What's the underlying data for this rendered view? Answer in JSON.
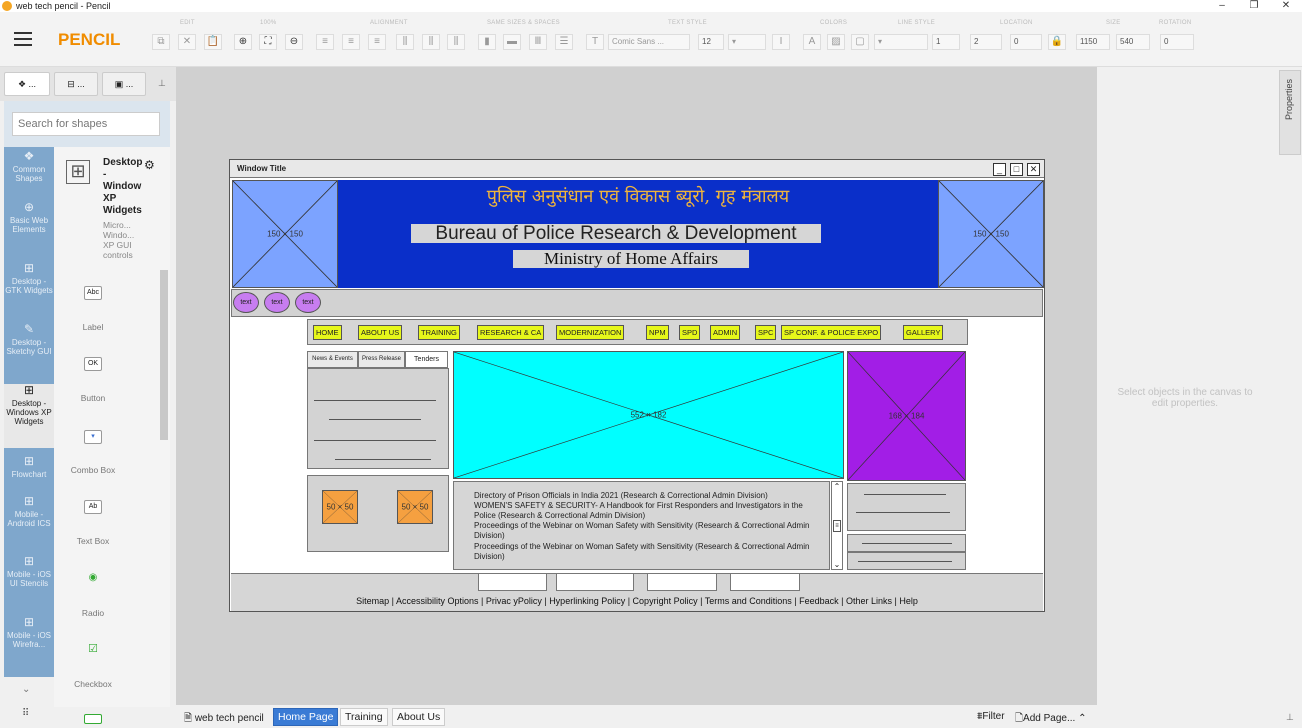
{
  "window": {
    "title": "web tech pencil - Pencil",
    "minimize": "–",
    "maximize": "❐",
    "close": "✕"
  },
  "app": {
    "name": "PENCIL"
  },
  "toolbar": {
    "groups": [
      "EDIT",
      "100%",
      "ALIGNMENT",
      "SAME SIZES & SPACES",
      "TEXT STYLE",
      "COLORS",
      "LINE STYLE",
      "LOCATION",
      "SIZE",
      "ROTATION"
    ],
    "font_family": "Comic Sans ...",
    "font_size": "12",
    "line_width": "1",
    "location_x": "2",
    "location_y": "0",
    "size_w": "1150",
    "size_h": "540",
    "rotation": "0"
  },
  "left": {
    "tab1": "...",
    "tab2": "...",
    "tab3": "...",
    "search_placeholder": "Search for shapes",
    "collections": [
      {
        "icon": "❖",
        "label": "Common Shapes"
      },
      {
        "icon": "⊕",
        "label": "Basic Web Elements"
      },
      {
        "icon": "⊞",
        "label": "Desktop - GTK Widgets"
      },
      {
        "icon": "✎",
        "label": "Desktop - Sketchy GUI"
      },
      {
        "icon": "⊞",
        "label": "Desktop - Windows XP Widgets"
      },
      {
        "icon": "⊞",
        "label": "Flowchart"
      },
      {
        "icon": "⊞",
        "label": "Mobile - Android ICS"
      },
      {
        "icon": "⊞",
        "label": "Mobile - iOS UI Stencils"
      },
      {
        "icon": "⊞",
        "label": "Mobile - iOS Wirefra..."
      }
    ],
    "collection_title": "Desktop - Window XP Widgets",
    "collection_desc": "Micro... Windo... XP GUI controls",
    "shapes": [
      {
        "icon": "Abc",
        "label": "Label"
      },
      {
        "icon": "OK",
        "label": "Button"
      },
      {
        "icon": "▾",
        "label": "Combo Box"
      },
      {
        "icon": "Ab",
        "label": "Text Box"
      },
      {
        "icon": "◉",
        "label": "Radio"
      },
      {
        "icon": "☑",
        "label": "Checkbox"
      }
    ]
  },
  "right": {
    "placeholder": "Select objects in the canvas to edit properties.",
    "properties_tab": "Properties"
  },
  "pages": {
    "doc": "web tech pencil",
    "tabs": [
      "Home Page",
      "Training",
      "About Us"
    ],
    "active": "Home Page",
    "filter": "Filter",
    "add_page": "Add Page..."
  },
  "mockup": {
    "window_title": "Window Title",
    "left_logo": "150 × 150",
    "right_logo": "150 × 150",
    "hindi_title": "पुलिस अनुसंधान एवं विकास ब्यूरो, गृह मंत्रालय",
    "bprd": "Bureau of Police Research & Development",
    "mha": "Ministry of Home Affairs",
    "circles": [
      "text",
      "text",
      "text"
    ],
    "nav": [
      "HOME",
      "ABOUT US",
      "TRAINING",
      "RESEARCH & CA",
      "MODERNIZATION",
      "NPM",
      "SPD",
      "ADMIN",
      "SPC",
      "SP CONF. & POLICE EXPO",
      "GALLERY"
    ],
    "side_tabs": [
      "News & Events",
      "Press Release",
      "Tenders"
    ],
    "hero": "552 × 182",
    "right_img": "168 × 184",
    "small1": "50 × 50",
    "small2": "50 × 50",
    "news": [
      "Directory of Prison Officials in India 2021 (Research & Correctional Admin Division)",
      "WOMEN'S SAFETY & SECURITY- A Handbook for First Responders and Investigators in the Police (Research & Correctional Admin Division)",
      "Proceedings of the Webinar on Woman Safety with Sensitivity (Research & Correctional Admin Division)",
      "Proceedings of the Webinar on Woman Safety with Sensitivity (Research & Correctional Admin Division)"
    ],
    "footer_links": "Sitemap | Accessibility Options | Privac yPolicy | Hyperlinking Policy | Copyright Policy | Terms and Conditions | Feedback | Other Links | Help"
  }
}
